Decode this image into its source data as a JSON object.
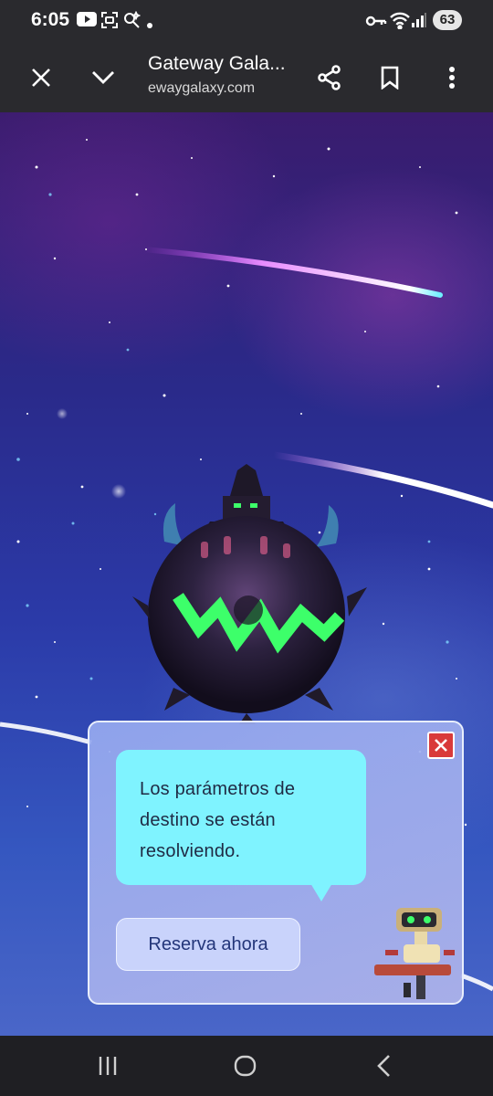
{
  "status_bar": {
    "time": "6:05",
    "battery": "63",
    "icons": [
      "youtube-icon",
      "screenshot-icon",
      "edit-spark-icon",
      "dot-icon",
      "key-icon",
      "wifi-icon",
      "signal-icon",
      "battery-icon"
    ]
  },
  "toolbar": {
    "title": "Gateway Gala...",
    "url": "ewaygalaxy.com",
    "icons": [
      "close-icon",
      "chevron-down-icon",
      "share-icon",
      "bookmark-icon",
      "more-vert-icon"
    ]
  },
  "dialog": {
    "message": "Los parámetros de destino se están resolviendo.",
    "button_label": "Reserva ahora"
  },
  "colors": {
    "bubble": "#7ff3ff",
    "button": "#c9d3fb",
    "close": "#d93a3a",
    "neon_green": "#3dff6a"
  },
  "nav_bar": {
    "icons": [
      "recents-icon",
      "home-icon",
      "back-icon"
    ]
  }
}
